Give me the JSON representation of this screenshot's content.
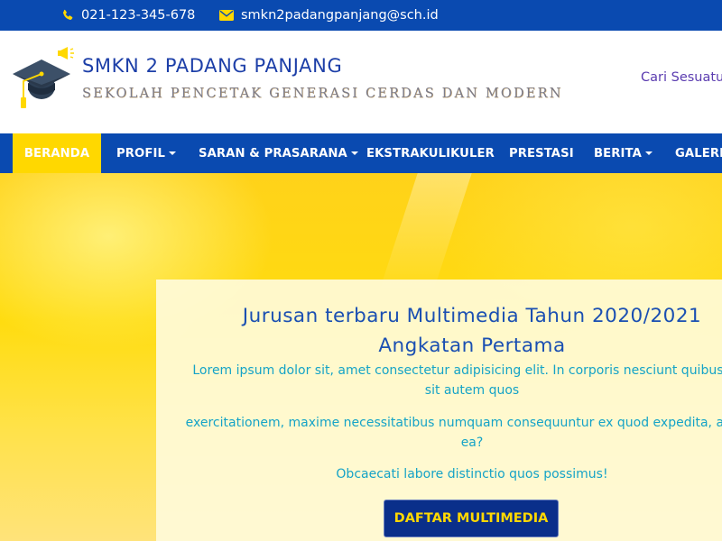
{
  "topbar": {
    "phone": "021-123-345-678",
    "email": "smkn2padangpanjang@sch.id",
    "phone_icon": "phone-icon",
    "email_icon": "envelope-icon",
    "accent_color": "#ffd800"
  },
  "header": {
    "school_name": "SMKN 2 PADANG PANJANG",
    "tagline": "SEKOLAH PENCETAK GENERASI CERDAS DAN MODERN",
    "search_link": "Cari Sesuatu"
  },
  "nav": {
    "items": [
      {
        "label": "BERANDA",
        "dropdown": false,
        "active": true
      },
      {
        "label": "PROFIL",
        "dropdown": true,
        "active": false
      },
      {
        "label": "SARAN & PRASARANA",
        "dropdown": true,
        "active": false
      },
      {
        "label": "EKSTRAKULIKULER",
        "dropdown": false,
        "active": false
      },
      {
        "label": "PRESTASI",
        "dropdown": false,
        "active": false
      },
      {
        "label": "BERITA",
        "dropdown": true,
        "active": false
      },
      {
        "label": "GALERI",
        "dropdown": false,
        "active": false
      }
    ]
  },
  "hero": {
    "title_line1": "Jurusan terbaru Multimedia Tahun 2020/2021",
    "title_line2": "Angkatan Pertama",
    "paragraph1_line1": "Lorem ipsum dolor sit, amet consectetur adipisicing elit. In corporis nesciunt quibusdam",
    "paragraph1_line2": "sit autem quos",
    "paragraph2_line1": "exercitationem, maxime necessitatibus numquam consequuntur ex quod expedita, aliquid",
    "paragraph2_line2": "ea?",
    "paragraph3": "Obcaecati labore distinctio quos possimus!",
    "cta_label": "DAFTAR MULTIMEDIA"
  },
  "colors": {
    "brand_blue": "#0a4ab0",
    "accent_yellow": "#ffd800",
    "cta_bg": "#0a2f8a",
    "hero_text": "#15a3c7"
  }
}
